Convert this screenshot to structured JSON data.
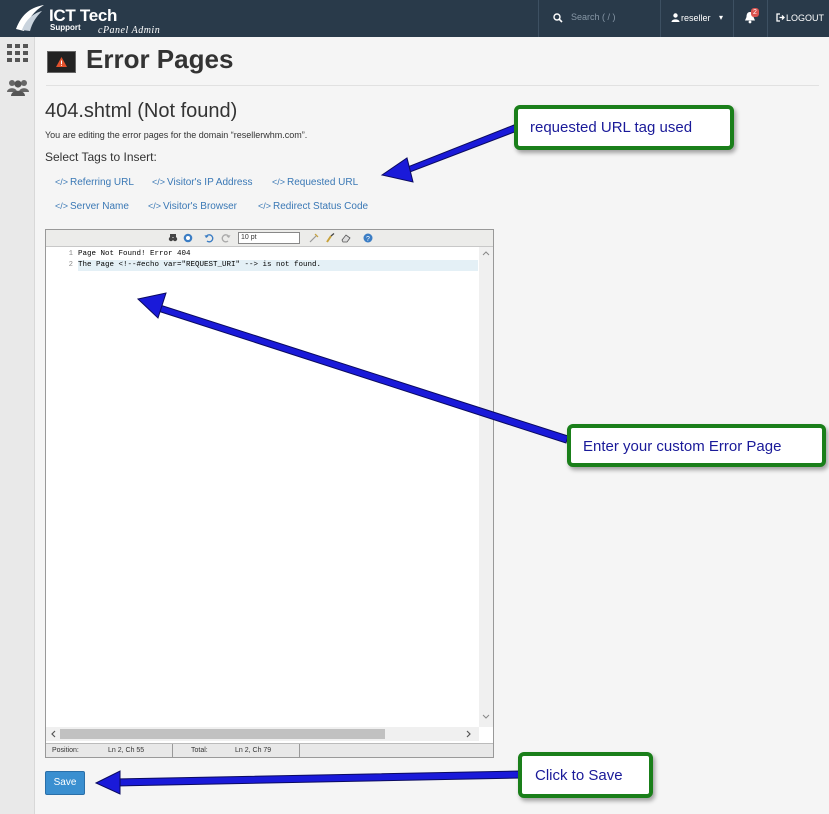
{
  "topbar": {
    "brand_title": "ICT Tech",
    "brand_sub": "Support",
    "brand_tag": "cPanel Admin",
    "search_placeholder": "Search ( / )",
    "username": "reseller",
    "notification_count": "2",
    "logout_label": "LOGOUT"
  },
  "header": {
    "title": "Error Pages"
  },
  "main": {
    "subtitle": "404.shtml (Not found)",
    "description": "You are editing the error pages for the domain “resellerwhm.com”.",
    "select_tags_label": "Select Tags to Insert:",
    "tags": [
      "Referring URL",
      "Visitor's IP Address",
      "Requested URL",
      "Server Name",
      "Visitor's Browser",
      "Redirect Status Code"
    ],
    "tag_code_glyph": "</>"
  },
  "editor": {
    "font_size": "10 pt",
    "lines": [
      {
        "number": "1",
        "text": "Page Not Found! Error 404"
      },
      {
        "number": "2",
        "text": "The Page <!--#echo var=\"REQUEST_URI\" --> is not found."
      }
    ],
    "status": {
      "position_label": "Position:",
      "position_value": "Ln 2, Ch 55",
      "total_label": "Total:",
      "total_value": "Ln 2, Ch 79"
    }
  },
  "save_label": "Save",
  "annotations": {
    "requested_url": "requested URL tag used",
    "custom_page": "Enter your custom Error Page",
    "click_save": "Click to Save"
  },
  "colors": {
    "topbar": "#293a4a",
    "link": "#3a78b5",
    "save_button": "#3a8fd0",
    "callout_border": "#1a7f1a",
    "arrow": "#1a1ad9"
  }
}
